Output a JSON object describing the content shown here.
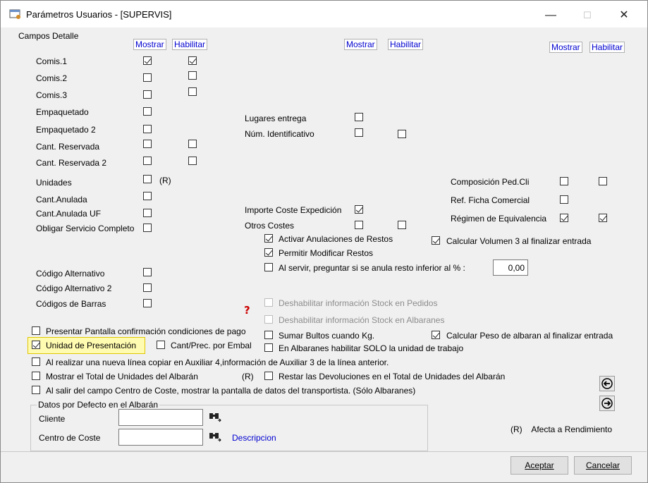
{
  "window": {
    "title": "Parámetros Usuarios - [SUPERVIS]",
    "minimize": "—",
    "maximize": "☐",
    "close": "✕"
  },
  "group_campos": "Campos Detalle",
  "headers": {
    "mostrar": "Mostrar",
    "habilitar": "Habilitar"
  },
  "col1": [
    "Comis.1",
    "Comis.2",
    "Comis.3",
    "Empaquetado",
    "Empaquetado 2",
    "Cant. Reservada",
    "Cant. Reservada 2",
    "Unidades",
    "Cant.Anulada",
    "Cant.Anulada UF",
    "Obligar Servicio Completo",
    "Código Alternativo",
    "Código Alternativo 2",
    "Códigos de Barras"
  ],
  "unidades_r": "(R)",
  "col2": [
    "Lugares entrega",
    "Núm. Identificativo",
    "Importe Coste Expedición",
    "Otros Costes"
  ],
  "col3": [
    "Composición Ped.Cli",
    "Ref. Ficha Comercial",
    "Régimen de Equivalencia"
  ],
  "restos": [
    "Activar Anulaciones de Restos",
    "Permitir Modificar Restos",
    "Al servir, preguntar si se anula resto inferior al % :"
  ],
  "resto_value": "0,00",
  "volumen": "Calcular Volumen 3 al finalizar entrada",
  "stock_pedidos": "Deshabilitar información Stock en Pedidos",
  "stock_albaranes": "Deshabilitar información Stock en Albaranes",
  "bultos": "Sumar Bultos cuando Kg.",
  "peso": "Calcular Peso de albaran al finalizar entrada",
  "solo_unidad": "En Albaranes habilitar SOLO la unidad de trabajo",
  "presentar": "Presentar Pantalla confirmación condiciones de pago",
  "unidad_presentacion": "Unidad de Presentación",
  "cant_prec": "Cant/Prec. por Embal",
  "auxiliar": "Al realizar una nueva línea copiar en Auxiliar 4,información de Auxiliar 3 de la línea anterior.",
  "mostrar_total": "Mostrar el Total de Unidades del Albarán",
  "r_mark": "(R)",
  "restar": "Restar las Devoluciones en el Total de Unidades del Albarán",
  "centro_coste_msg": "Al salir del campo Centro de Coste, mostrar la pantalla de datos del transportista. (Sólo Albaranes)",
  "group_defecto": "Datos por Defecto en el Albarán",
  "cliente": "Cliente",
  "centro_coste": "Centro de Coste",
  "descripcion": "Descripcion",
  "afecta": "(R)    Afecta a Rendimiento",
  "aceptar": "Aceptar",
  "cancelar": "Cancelar"
}
